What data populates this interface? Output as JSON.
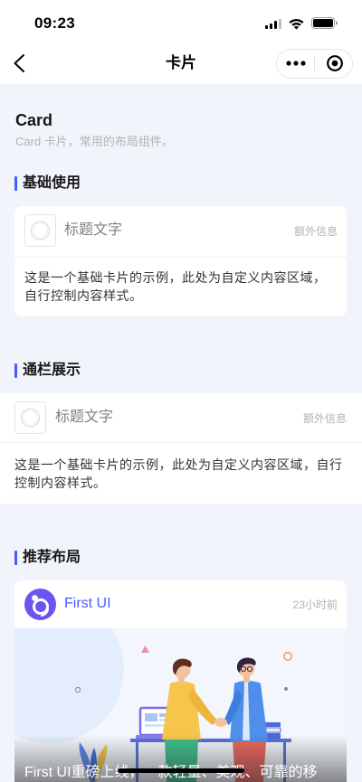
{
  "status_bar": {
    "time": "09:23",
    "icons": {
      "signal": "signal-icon",
      "wifi": "wifi-icon",
      "battery": "battery-icon"
    }
  },
  "nav": {
    "title": "卡片",
    "back_icon": "back-chevron-icon",
    "more_icon": "more-icon",
    "exit_icon": "exit-icon"
  },
  "header": {
    "title": "Card",
    "description": "Card 卡片，常用的布局组件。"
  },
  "sections": [
    {
      "heading": "基础使用",
      "card": {
        "icon": "card-avatar-icon",
        "title": "标题文字",
        "extra": "额外信息",
        "body": "这是一个基础卡片的示例，此处为自定义内容区域，自行控制内容样式。"
      }
    },
    {
      "heading": "通栏展示",
      "card": {
        "icon": "card-avatar-icon",
        "title": "标题文字",
        "extra": "额外信息",
        "body": "这是一个基础卡片的示例，此处为自定义内容区域，自行控制内容样式。"
      }
    },
    {
      "heading": "推荐布局",
      "card": {
        "icon": "first-ui-logo-icon",
        "title": "First UI",
        "extra": "23小时前",
        "image": "handshake-illustration",
        "caption": "First UI重磅上线，一款轻量、美观、可靠的移"
      }
    }
  ],
  "colors": {
    "primary": "#465CFF",
    "page_background": "#F1F4FA",
    "card_background": "#FFFFFF",
    "heading_text": "#181818",
    "card_title_text": "#7F7F7F",
    "muted_text": "#B2B2B2",
    "body_text": "#333333"
  }
}
